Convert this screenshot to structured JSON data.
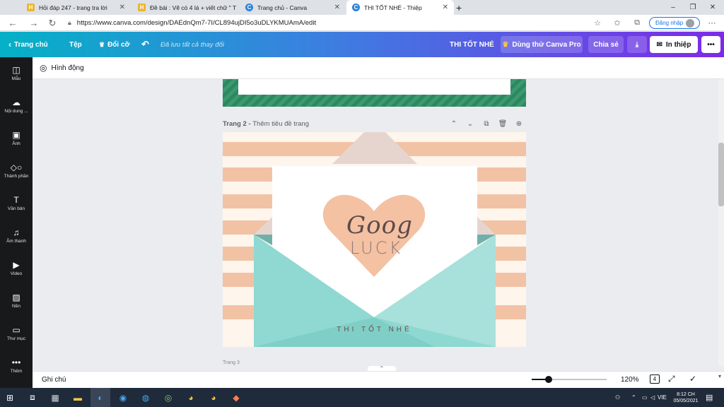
{
  "browser": {
    "tabs": [
      {
        "title": "Hỏi đáp 247 - trang tra lời",
        "favicon": "H"
      },
      {
        "title": "Đề bài : Vẽ có 4 lá + viết chữ \" T",
        "favicon": "H"
      },
      {
        "title": "Trang chủ - Canva",
        "favicon": "C"
      },
      {
        "title": "THI TỐT NHÉ - Thiệp",
        "favicon": "C"
      }
    ],
    "url": "https://www.canva.com/design/DAEdnQm7-7I/CL894ujDI5o3uDLYKMUAmA/edit",
    "signin_label": "Đăng nhập",
    "window_controls": [
      "–",
      "❐",
      "✕"
    ]
  },
  "canva_header": {
    "home_label": "Trang chủ",
    "file_label": "Tệp",
    "resize_label": "Đổi cỡ",
    "saved_status": "Đã lưu tất cả thay đổi",
    "design_title": "THI TỐT NHÉ",
    "try_pro_label": "Dùng thử Canva Pro",
    "share_label": "Chia sẻ",
    "print_label": "In thiệp",
    "more_label": "•••"
  },
  "sidebar": {
    "items": [
      {
        "label": "Mẫu",
        "icon": "template-icon"
      },
      {
        "label": "Nội dung ...",
        "icon": "upload-icon"
      },
      {
        "label": "Ảnh",
        "icon": "photo-icon"
      },
      {
        "label": "Thành phần",
        "icon": "elements-icon"
      },
      {
        "label": "Văn bản",
        "icon": "text-icon"
      },
      {
        "label": "Âm thanh",
        "icon": "music-icon"
      },
      {
        "label": "Video",
        "icon": "video-icon"
      },
      {
        "label": "Nền",
        "icon": "background-icon"
      },
      {
        "label": "Thư mục",
        "icon": "folder-icon"
      },
      {
        "label": "Thêm",
        "icon": "more-icon"
      }
    ]
  },
  "toolbar": {
    "animate_label": "Hình động"
  },
  "page": {
    "header_prefix": "Trang 2 - ",
    "header_placeholder": "Thêm tiêu đề trang",
    "heart_text_top": "Goog",
    "heart_text_bottom": "LUCK",
    "envelope_text": "THI TỐT NHÉ",
    "next_page_label": "Trang 3"
  },
  "bottom_bar": {
    "notes_label": "Ghi chú",
    "zoom_level": "120%",
    "page_count": "4"
  },
  "taskbar": {
    "language": "VIE",
    "time": "8:12 CH",
    "date": "05/05/2021"
  },
  "colors": {
    "header_gradient_start": "#05b1c6",
    "header_gradient_end": "#7d2ae8",
    "stripe": "#f2c2a5",
    "heart": "#f4c1a3",
    "envelope": "#8dd8d0",
    "sidebar": "#18191b"
  }
}
